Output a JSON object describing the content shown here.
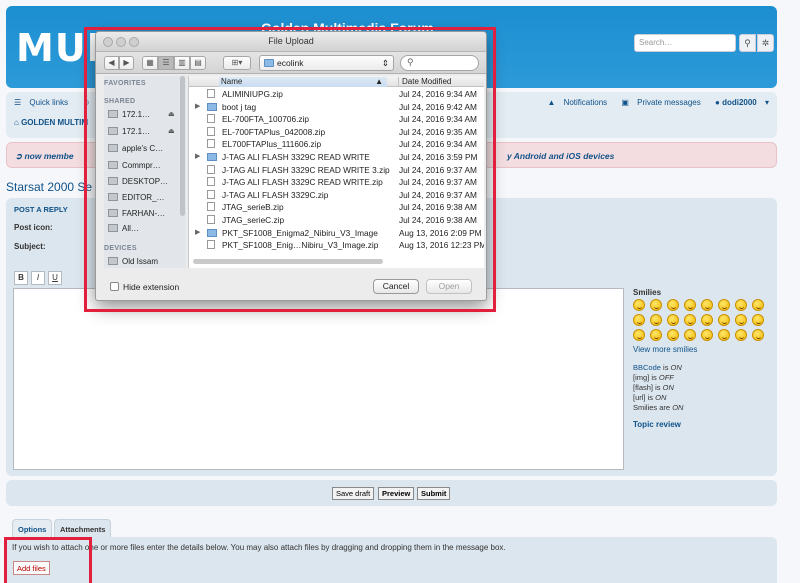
{
  "forum": {
    "logo_text": "MUL",
    "site_title": "Golden Multimedia Forum",
    "search_placeholder": "Search…",
    "search_icon": "search-icon",
    "advanced_icon": "gear-icon"
  },
  "nav": {
    "quick_links": "Quick links",
    "view_label": "Vi",
    "notifications": "Notifications",
    "private_messages": "Private messages",
    "username": "dodi2000",
    "breadcrumb": "GOLDEN MULTIM"
  },
  "announcement": {
    "left": "now membe",
    "right": "y Android and iOS devices"
  },
  "topic": {
    "title": "Starsat 2000 Se"
  },
  "post_form": {
    "post_reply": "POST A REPLY",
    "post_icon_label": "Post icon:",
    "subject_label": "Subject:",
    "bbcode_buttons": [
      "B",
      "I",
      "U"
    ],
    "smilies_label": "Smilies",
    "view_more_smilies": "View more smilies",
    "bbcode_status": [
      {
        "name": "BBCode",
        "mid": " is ",
        "state": "ON"
      },
      {
        "name": "[img]",
        "mid": " is ",
        "state": "OFF"
      },
      {
        "name": "[flash]",
        "mid": " is ",
        "state": "ON"
      },
      {
        "name": "[url]",
        "mid": " is ",
        "state": "ON"
      },
      {
        "name": "Smilies",
        "mid": " are ",
        "state": "ON"
      }
    ],
    "topic_review": "Topic review",
    "save_draft": "Save draft",
    "preview": "Preview",
    "submit": "Submit"
  },
  "tabs": {
    "options": "Options",
    "attachments": "Attachments"
  },
  "attachments": {
    "instructions": "If you wish to attach one or more files enter the details below. You may also attach files by dragging and dropping them in the message box.",
    "add_files": "Add files"
  },
  "dialog": {
    "title": "File Upload",
    "location": "ecolink",
    "sidebar": {
      "favorites_header": "FAVORITES",
      "shared_header": "SHARED",
      "devices_header": "DEVICES",
      "shared_items": [
        "172.1…",
        "172.1…",
        "apple's C…",
        "Commpr…",
        "DESKTOP…",
        "EDITOR_…",
        "FARHAN-…",
        "All…"
      ],
      "device_items": [
        "Old Issam"
      ]
    },
    "columns": {
      "name": "Name",
      "date": "Date Modified"
    },
    "files": [
      {
        "name": "ALIMINIUPG.zip",
        "date": "Jul 24, 2016 9:34 AM",
        "folder": false
      },
      {
        "name": "boot j tag",
        "date": "Jul 24, 2016 9:42 AM",
        "folder": true
      },
      {
        "name": "EL-700FTA_100706.zip",
        "date": "Jul 24, 2016 9:34 AM",
        "folder": false
      },
      {
        "name": "EL-700FTAPlus_042008.zip",
        "date": "Jul 24, 2016 9:35 AM",
        "folder": false
      },
      {
        "name": "EL700FTAPlus_111606.zip",
        "date": "Jul 24, 2016 9:34 AM",
        "folder": false
      },
      {
        "name": "J-TAG ALI FLASH 3329C READ WRITE",
        "date": "Jul 24, 2016 3:59 PM",
        "folder": true
      },
      {
        "name": "J-TAG ALI FLASH 3329C READ WRITE 3.zip",
        "date": "Jul 24, 2016 9:37 AM",
        "folder": false
      },
      {
        "name": "J-TAG ALI FLASH 3329C READ WRITE.zip",
        "date": "Jul 24, 2016 9:37 AM",
        "folder": false
      },
      {
        "name": "J-TAG ALI FLASH 3329C.zip",
        "date": "Jul 24, 2016 9:37 AM",
        "folder": false
      },
      {
        "name": "JTAG_serieB.zip",
        "date": "Jul 24, 2016 9:38 AM",
        "folder": false
      },
      {
        "name": "JTAG_serieC.zip",
        "date": "Jul 24, 2016 9:38 AM",
        "folder": false
      },
      {
        "name": "PKT_SF1008_Enigma2_Nibiru_V3_Image",
        "date": "Aug 13, 2016 2:09 PM",
        "folder": true
      },
      {
        "name": "PKT_SF1008_Enig…Nibiru_V3_Image.zip",
        "date": "Aug 13, 2016 12:23 PM",
        "folder": false
      }
    ],
    "hide_extension": "Hide extension",
    "cancel": "Cancel",
    "open": "Open"
  },
  "colors": {
    "header_blue": "#1c8fd1",
    "link_blue": "#105289",
    "highlight_red": "#e21f3d",
    "panel_bg": "#dce6ee"
  }
}
